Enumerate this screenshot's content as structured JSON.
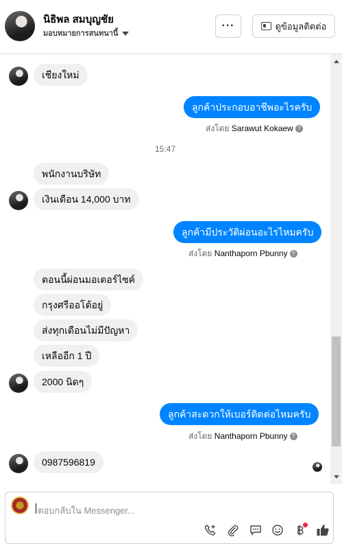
{
  "header": {
    "name": "นิธิพล สมบุญชัย",
    "subtitle": "มอบหมายการสนทนานี้",
    "more_label": "···",
    "contact_label": "ดูข้อมูลติดต่อ"
  },
  "messages": {
    "m1": "เชียงใหม่",
    "m2": "ลูกค้าประกอบอาชีพอะไรครับ",
    "m2_by_prefix": "ส่งโดย",
    "m2_by": "Sarawut Kokaew",
    "time1": "15:47",
    "m3": "พนักงานบริษัท",
    "m4": "เงินเดือน 14,000 บาท",
    "m5": "ลูกค้ามีประวัติผ่อนอะไรไหมครับ",
    "m5_by_prefix": "ส่งโดย",
    "m5_by": "Nanthaporn Pbunny",
    "m6": "ตอนนี้ผ่อนมอเตอร์ไซค์",
    "m7": "กรุงศรีออโต้อยู่",
    "m8": "ส่งทุกเดือนไม่มีปัญหา",
    "m9": "เหลืออีก 1 ปี",
    "m10": "2000 นิดๆ",
    "m11": "ลูกค้าสะดวกให้เบอร์ติดต่อไหมครับ",
    "m11_by_prefix": "ส่งโดย",
    "m11_by": "Nanthaporn Pbunny",
    "m12": "0987596819"
  },
  "composer": {
    "placeholder": "ตอบกลับใน Messenger...",
    "tools": [
      "phone-add-icon",
      "attachment-icon",
      "saved-reply-icon",
      "emoji-icon",
      "baht-payment-icon",
      "thumbs-up-icon"
    ]
  },
  "colors": {
    "outgoing": "#0084ff",
    "incoming": "#f0f0f0",
    "notification_dot": "#f02849"
  }
}
